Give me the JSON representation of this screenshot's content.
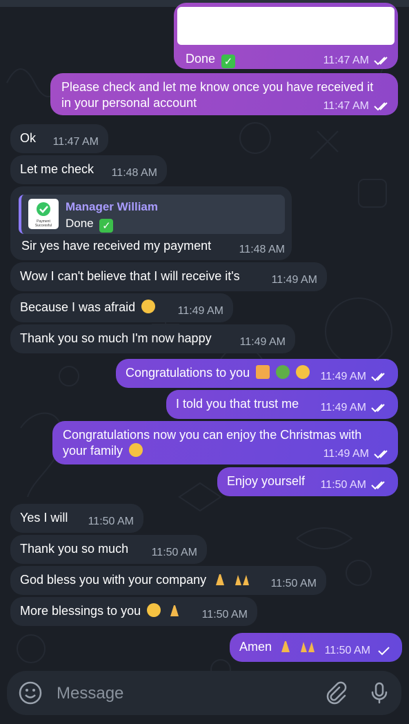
{
  "colors": {
    "background": "#1b1f26",
    "incoming_bubble": "#252b35",
    "outgoing_bubble_pink": "#a24dc6",
    "outgoing_bubble_purple": "#7b47d6",
    "reply_accent": "#8d7bff",
    "time_text": "#aab3bf"
  },
  "messages": [
    {
      "direction": "out",
      "text": "Done",
      "emoji": "check-mark-button",
      "time": "11:47 AM",
      "status": "read"
    },
    {
      "direction": "out",
      "text": "Please check and let me know once you have received it in your personal account",
      "time": "11:47 AM",
      "status": "read"
    },
    {
      "direction": "in",
      "text": "Ok",
      "time": "11:47 AM"
    },
    {
      "direction": "in",
      "text": "Let me check",
      "time": "11:48 AM"
    },
    {
      "direction": "in",
      "text": "Sir yes have received my payment",
      "time": "11:48 AM",
      "reply": {
        "name": "Manager William",
        "text": "Done",
        "thumbnail_text": "Payment Successful"
      }
    },
    {
      "direction": "in",
      "text": "Wow I can't believe that I will receive it's",
      "time": "11:49 AM"
    },
    {
      "direction": "in",
      "text": "Because I was afraid",
      "emoji": "loudly-crying-face",
      "time": "11:49 AM"
    },
    {
      "direction": "in",
      "text": "Thank you so much I'm now happy",
      "time": "11:49 AM"
    },
    {
      "direction": "out",
      "text": "Congratulations to you",
      "emoji": "party-popper bouquet clapping-hands",
      "time": "11:49 AM",
      "status": "read"
    },
    {
      "direction": "out",
      "text": "I told you that trust me",
      "time": "11:49 AM",
      "status": "read"
    },
    {
      "direction": "out",
      "text": "Congratulations now you can enjoy the Christmas with your family",
      "emoji": "smiling-face",
      "time": "11:49 AM",
      "status": "read"
    },
    {
      "direction": "out",
      "text": "Enjoy yourself",
      "time": "11:50 AM",
      "status": "read"
    },
    {
      "direction": "in",
      "text": "Yes I will",
      "time": "11:50 AM"
    },
    {
      "direction": "in",
      "text": "Thank you so much",
      "time": "11:50 AM"
    },
    {
      "direction": "in",
      "text": "God bless you with your company",
      "emoji": "folded-hands raising-hands",
      "time": "11:50 AM"
    },
    {
      "direction": "in",
      "text": "More blessings to you",
      "emoji": "smiling-face folded-hands",
      "time": "11:50 AM"
    },
    {
      "direction": "out",
      "text": "Amen",
      "emoji": "folded-hands raising-hands",
      "time": "11:50 AM",
      "status": "sent"
    }
  ],
  "composer": {
    "placeholder": "Message",
    "emoji_icon": "smile-icon",
    "attach_icon": "paperclip-icon",
    "mic_icon": "microphone-icon"
  }
}
